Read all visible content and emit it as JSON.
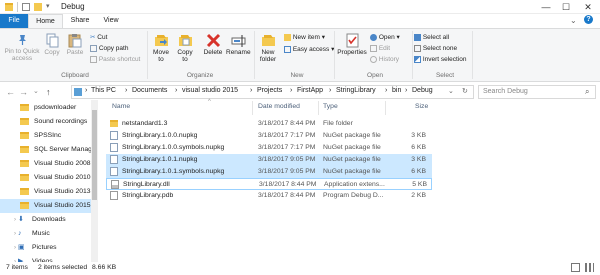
{
  "window": {
    "title": "Debug",
    "controls": [
      "—",
      "☐",
      "✕"
    ]
  },
  "tabs": [
    "File",
    "Home",
    "Share",
    "View"
  ],
  "ribbon": {
    "clipboard": {
      "pin": "Pin to Quick access",
      "copy": "Copy",
      "paste": "Paste",
      "cut": "Cut",
      "copy_path": "Copy path",
      "paste_shortcut": "Paste shortcut",
      "label": "Clipboard"
    },
    "organize": {
      "move_to": "Move to",
      "copy_to": "Copy to",
      "delete": "Delete",
      "rename": "Rename",
      "label": "Organize"
    },
    "new": {
      "new_folder": "New folder",
      "new_item": "New item ▾",
      "easy_access": "Easy access ▾",
      "label": "New"
    },
    "open": {
      "properties": "Properties",
      "open": "Open ▾",
      "edit": "Edit",
      "history": "History",
      "label": "Open"
    },
    "select": {
      "select_all": "Select all",
      "select_none": "Select none",
      "invert": "Invert selection",
      "label": "Select"
    }
  },
  "address": {
    "crumbs": [
      "This PC",
      "Documents",
      "visual studio 2015",
      "Projects",
      "FirstApp",
      "StringLibrary",
      "bin",
      "Debug"
    ],
    "search_placeholder": "Search Debug"
  },
  "nav_pane": [
    {
      "label": "psdownloader",
      "selected": false
    },
    {
      "label": "Sound recordings",
      "selected": false
    },
    {
      "label": "SPSSInc",
      "selected": false
    },
    {
      "label": "SQL Server Manag",
      "selected": false
    },
    {
      "label": "Visual Studio 2008",
      "selected": false
    },
    {
      "label": "Visual Studio 2010",
      "selected": false
    },
    {
      "label": "Visual Studio 2013",
      "selected": false
    },
    {
      "label": "Visual Studio 2015",
      "selected": true
    },
    {
      "label": "Downloads",
      "selected": false
    },
    {
      "label": "Music",
      "selected": false
    },
    {
      "label": "Pictures",
      "selected": false
    },
    {
      "label": "Videos",
      "selected": false
    }
  ],
  "columns": [
    "Name",
    "Date modified",
    "Type",
    "Size"
  ],
  "files": [
    {
      "name": "netstandard1.3",
      "date": "3/18/2017 8:44 PM",
      "type": "File folder",
      "size": "",
      "kind": "folder",
      "selected": false
    },
    {
      "name": "StringLibrary.1.0.0.nupkg",
      "date": "3/18/2017 7:17 PM",
      "type": "NuGet package file",
      "size": "3 KB",
      "kind": "nupkg",
      "selected": false
    },
    {
      "name": "StringLibrary.1.0.0.symbols.nupkg",
      "date": "3/18/2017 7:17 PM",
      "type": "NuGet package file",
      "size": "6 KB",
      "kind": "nupkg",
      "selected": false
    },
    {
      "name": "StringLibrary.1.0.1.nupkg",
      "date": "3/18/2017 9:05 PM",
      "type": "NuGet package file",
      "size": "3 KB",
      "kind": "nupkg",
      "selected": true
    },
    {
      "name": "StringLibrary.1.0.1.symbols.nupkg",
      "date": "3/18/2017 9:05 PM",
      "type": "NuGet package file",
      "size": "6 KB",
      "kind": "nupkg",
      "selected": true
    },
    {
      "name": "StringLibrary.dll",
      "date": "3/18/2017 8:44 PM",
      "type": "Application extens...",
      "size": "5 KB",
      "kind": "dll",
      "selected": false
    },
    {
      "name": "StringLibrary.pdb",
      "date": "3/18/2017 8:44 PM",
      "type": "Program Debug D...",
      "size": "2 KB",
      "kind": "pdb",
      "selected": false
    }
  ],
  "status": {
    "items": "7 items",
    "selected": "2 items selected",
    "size": "8.66 KB"
  },
  "colors": {
    "accent": "#1979ca",
    "selection": "#cce8ff",
    "folder": "#f4c94f"
  }
}
